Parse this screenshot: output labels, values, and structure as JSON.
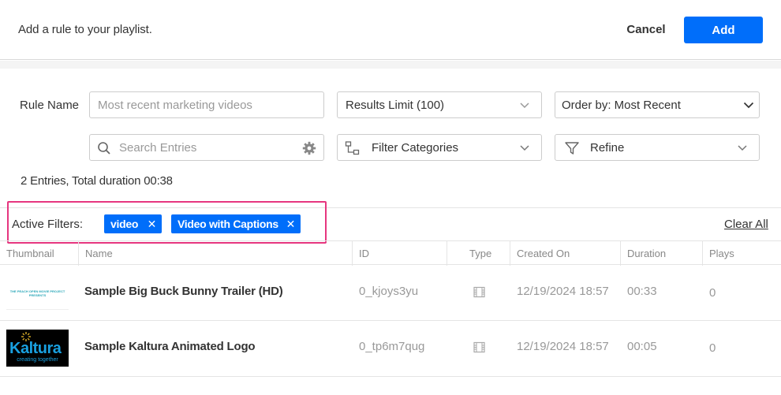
{
  "header": {
    "title": "Add a rule to your playlist.",
    "cancel_label": "Cancel",
    "add_label": "Add"
  },
  "form": {
    "rule_name_label": "Rule Name",
    "rule_name_placeholder": "Most recent marketing videos",
    "results_limit": "Results Limit (100)",
    "order_by": "Order by: Most Recent",
    "search_placeholder": "Search Entries",
    "filter_categories": "Filter Categories",
    "refine": "Refine"
  },
  "summary": "2 Entries, Total duration 00:38",
  "active_filters": {
    "label": "Active Filters:",
    "chips": [
      "video",
      "Video with Captions"
    ],
    "clear_all": "Clear All"
  },
  "table": {
    "columns": [
      "Thumbnail",
      "Name",
      "ID",
      "Type",
      "Created On",
      "Duration",
      "Plays"
    ],
    "rows": [
      {
        "thumbnail_caption": "THE PEACH OPEN MOVIE PROJECT PRESENTS",
        "name": "Sample Big Buck Bunny Trailer (HD)",
        "id": "0_kjoys3yu",
        "type_icon": "film-icon",
        "created_on": "12/19/2024 18:57",
        "duration": "00:33",
        "plays": "0"
      },
      {
        "thumbnail_caption": "Kaltura",
        "thumbnail_tagline": "creating together",
        "name": "Sample Kaltura Animated Logo",
        "id": "0_tp6m7qug",
        "type_icon": "film-icon",
        "created_on": "12/19/2024 18:57",
        "duration": "00:05",
        "plays": "0"
      }
    ]
  },
  "colors": {
    "accent": "#006efa",
    "highlight_border": "#e6367f"
  }
}
